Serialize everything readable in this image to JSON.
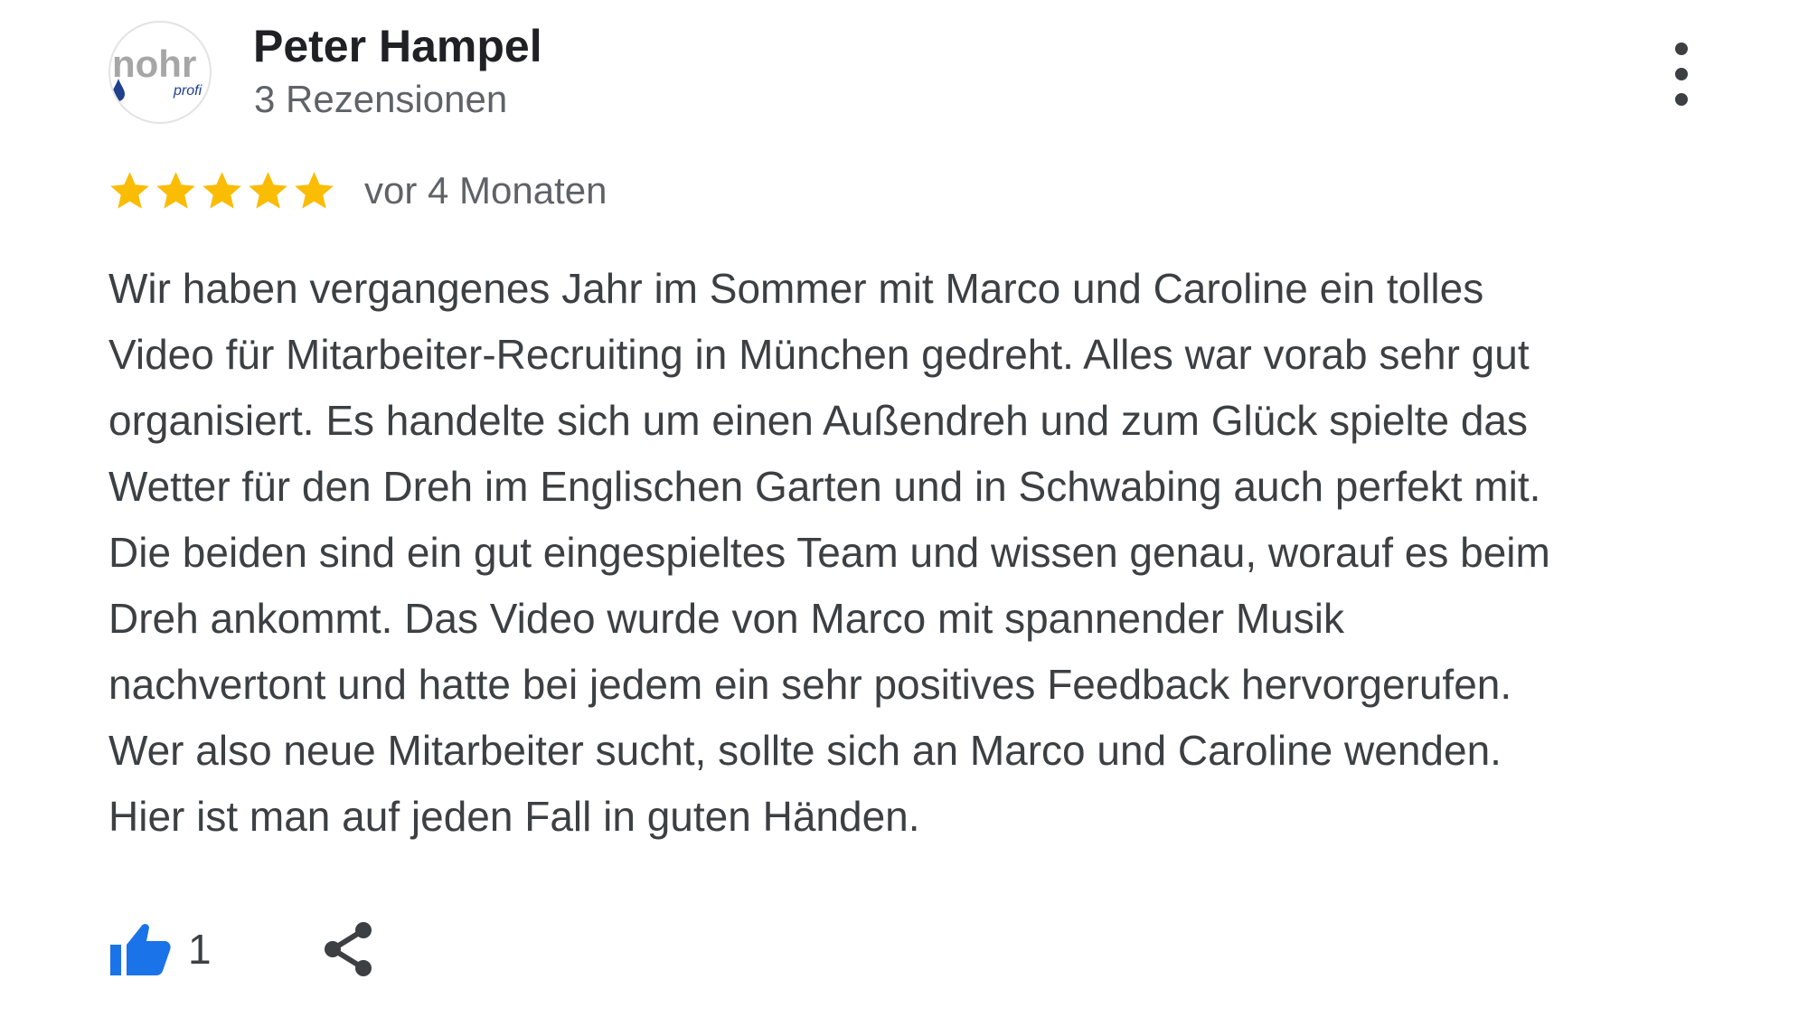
{
  "author": {
    "name": "Peter Hampel",
    "review_count": "3 Rezensionen",
    "avatar_logo": {
      "word": "nohr",
      "sub": "profi",
      "icon": "water-drop-icon"
    }
  },
  "review": {
    "rating": 5,
    "max_rating": 5,
    "date": "vor 4 Monaten",
    "text_lines": [
      "Wir haben vergangenes Jahr im Sommer mit Marco und Caroline ein tolles",
      "Video für Mitarbeiter-Recruiting in München gedreht. Alles war vorab sehr gut",
      "organisiert. Es handelte sich um einen Außendreh und zum Glück spielte das",
      "Wetter für den Dreh im Englischen Garten und in Schwabing auch perfekt mit.",
      "Die beiden sind ein gut eingespieltes Team und wissen genau, worauf es beim",
      "Dreh ankommt. Das Video wurde von Marco mit spannender Musik",
      "nachvertont und hatte bei jedem ein sehr positives Feedback hervorgerufen.",
      "Wer also neue Mitarbeiter sucht, sollte sich an Marco und Caroline wenden.",
      "Hier ist man auf jeden Fall in guten Händen."
    ]
  },
  "actions": {
    "like_icon": "thumbs-up-icon",
    "like_count": "1",
    "share_icon": "share-icon",
    "menu_icon": "more-vert-icon"
  },
  "colors": {
    "star": "#fbbc04",
    "like": "#1a73e8",
    "logo_text": "#a6a6a6",
    "logo_sub": "#1f3f8f",
    "drop": "#1f3f8f"
  }
}
